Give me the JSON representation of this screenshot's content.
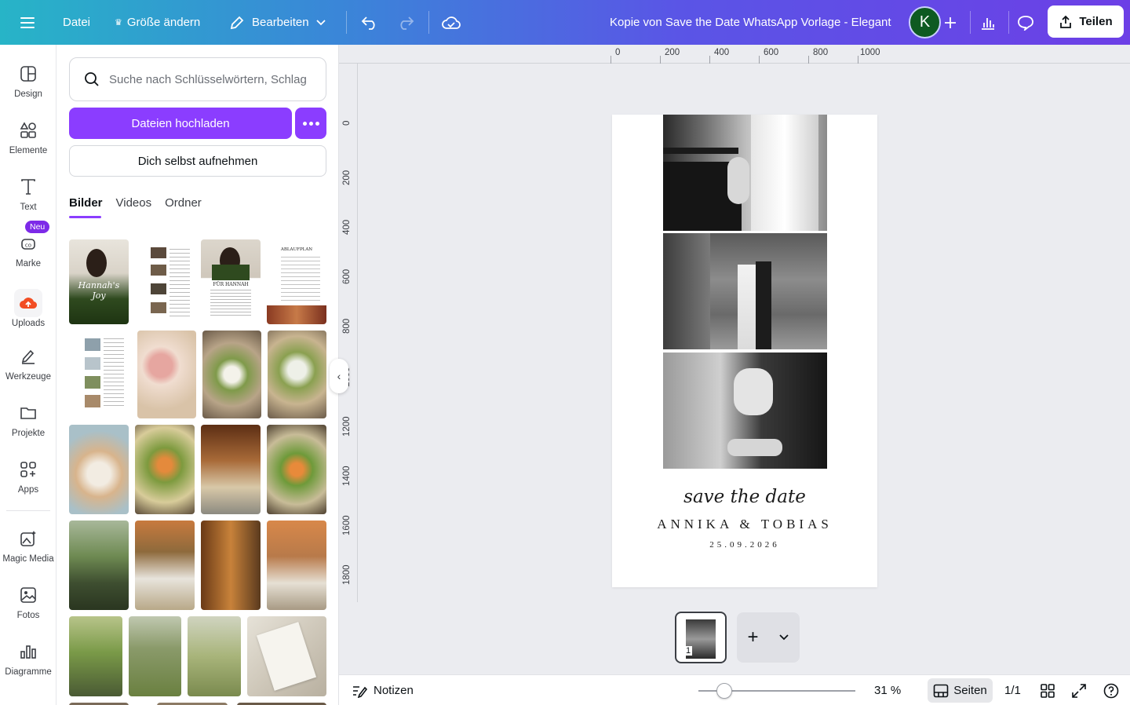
{
  "topbar": {
    "menu_icon": "menu-icon",
    "file_label": "Datei",
    "resize_label": "Größe ändern",
    "edit_label": "Bearbeiten",
    "doc_title": "Kopie von Save the Date WhatsApp Vorlage - Elegant",
    "avatar_initial": "K",
    "share_label": "Teilen"
  },
  "rail": {
    "items": [
      {
        "label": "Design",
        "icon": "layout-icon"
      },
      {
        "label": "Elemente",
        "icon": "shapes-icon"
      },
      {
        "label": "Text",
        "icon": "text-icon"
      },
      {
        "label": "Marke",
        "icon": "brand-icon"
      },
      {
        "label": "Uploads",
        "icon": "cloud-upload-icon"
      },
      {
        "label": "Werkzeuge",
        "icon": "draw-icon"
      },
      {
        "label": "Projekte",
        "icon": "folder-icon"
      },
      {
        "label": "Apps",
        "icon": "apps-icon"
      },
      {
        "label": "Magic Media",
        "icon": "magic-media-icon"
      },
      {
        "label": "Fotos",
        "icon": "photo-icon"
      },
      {
        "label": "Diagramme",
        "icon": "chart-icon"
      }
    ],
    "new_badge": "Neu"
  },
  "panel": {
    "search_placeholder": "Suche nach Schlüsselwörtern, Schlag",
    "upload_label": "Dateien hochladen",
    "record_label": "Dich selbst aufnehmen",
    "tabs": [
      "Bilder",
      "Videos",
      "Ordner"
    ],
    "thumb_texts": {
      "t1": "Hannah's\nJoy",
      "t3": "FÜR HANNAH",
      "t4": "ABLAUFPLAN"
    }
  },
  "canvas": {
    "ruler_top": [
      "0",
      "200",
      "400",
      "600",
      "800",
      "1000"
    ],
    "ruler_left": [
      "0",
      "200",
      "400",
      "600",
      "800",
      "1000",
      "1200",
      "1400",
      "1600",
      "1800"
    ],
    "script_line": "save the date",
    "names": "ANNIKA & TOBIAS",
    "date": "25.09.2026",
    "page_number": "1"
  },
  "bottombar": {
    "notes_label": "Notizen",
    "zoom": "31 %",
    "zoom_level": 0.31,
    "pages_label": "Seiten",
    "page_count": "1/1"
  },
  "colors": {
    "accent": "#8b3dff",
    "topbar_start": "#27b4c7",
    "topbar_end": "#6c3fe6"
  }
}
